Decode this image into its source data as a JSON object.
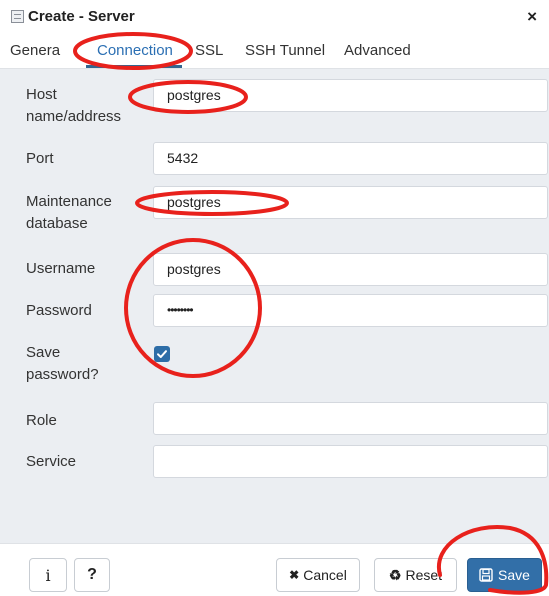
{
  "window": {
    "title": "Create - Server",
    "close_glyph": "×"
  },
  "tabs": [
    {
      "label": "General",
      "display": "Genera",
      "active": false
    },
    {
      "label": "Connection",
      "active": true
    },
    {
      "label": "SSL",
      "active": false
    },
    {
      "label": "SSH Tunnel",
      "active": false
    },
    {
      "label": "Advanced",
      "active": false
    }
  ],
  "form": {
    "host": {
      "label_line1": "Host",
      "label_line2": "name/address",
      "value": "postgres"
    },
    "port": {
      "label": "Port",
      "value": "5432"
    },
    "maintenance_db": {
      "label_line1": "Maintenance",
      "label_line2": "database",
      "value": "postgres"
    },
    "username": {
      "label": "Username",
      "value": "postgres"
    },
    "password": {
      "label": "Password",
      "value": "••••••••"
    },
    "save_password": {
      "label_line1": "Save",
      "label_line2": "password?",
      "checked": true
    },
    "role": {
      "label": "Role",
      "value": ""
    },
    "service": {
      "label": "Service",
      "value": ""
    }
  },
  "footer": {
    "info_glyph": "i",
    "help_glyph": "?",
    "cancel_label": "Cancel",
    "cancel_glyph": "✖",
    "reset_label": "Reset",
    "reset_glyph": "♻",
    "save_label": "Save",
    "save_glyph": "🖫"
  },
  "colors": {
    "accent": "#326fa8",
    "form_background": "#ebeef2",
    "annotation": "#e8211c"
  }
}
